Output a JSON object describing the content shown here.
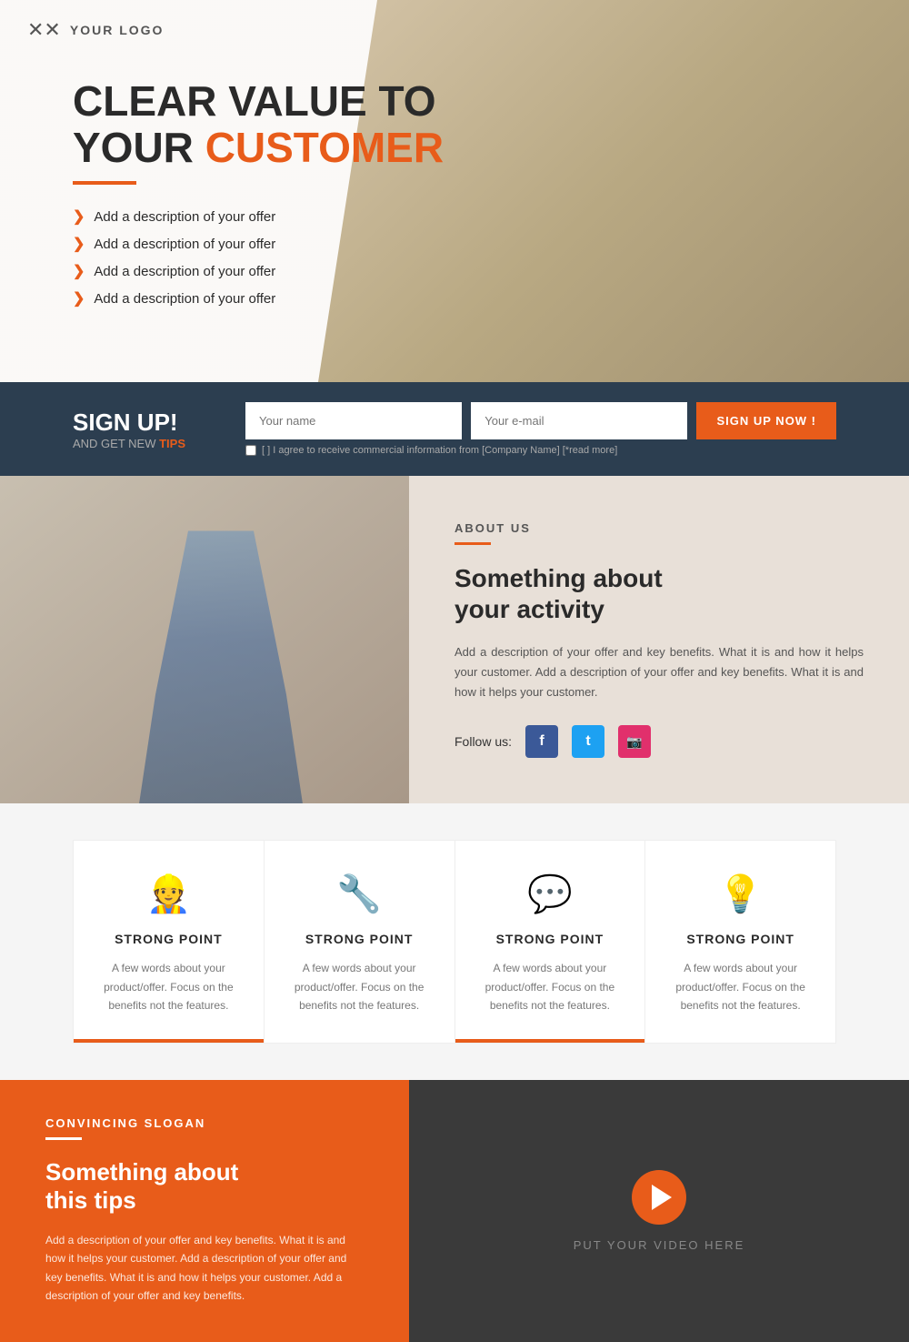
{
  "logo": {
    "icon": "🔧",
    "text": "YOUR LOGO"
  },
  "hero": {
    "title_line1": "CLEAR VALUE TO",
    "title_line2": "YOUR ",
    "title_highlight": "CUSTOMER",
    "features": [
      "Add a description of your offer",
      "Add a description of your offer",
      "Add a description of your offer",
      "Add a description of your offer"
    ]
  },
  "signup": {
    "headline": "SIGN UP!",
    "subline": "AND GET NEW ",
    "subline_highlight": "TIPS",
    "name_placeholder": "Your name",
    "email_placeholder": "Your e-mail",
    "button_label": "SIGN UP NOW !",
    "agree_text": "[ ] I agree to receive commercial information from [Company Name] [*read more]"
  },
  "about": {
    "section_label": "ABOUT US",
    "heading_line1": "Something about",
    "heading_line2": "your activity",
    "description": "Add a description of your offer and key benefits. What it is and how it helps your customer. Add a description of your offer and key benefits. What it is and how it helps your customer.",
    "follow_label": "Follow us:"
  },
  "strong_points": [
    {
      "icon": "👷",
      "title": "STRONG POINT",
      "text": "A few words about your product/offer. Focus on the benefits not the features."
    },
    {
      "icon": "🔧",
      "title": "STRONG POINT",
      "text": "A few words about your product/offer. Focus on the benefits not the features."
    },
    {
      "icon": "💬",
      "title": "STRONG POINT",
      "text": "A few words about your product/offer. Focus on the benefits not the features."
    },
    {
      "icon": "💡",
      "title": "STRONG POINT",
      "text": "A few words about your product/offer. Focus on the benefits not the features."
    }
  ],
  "slogan": {
    "label": "CONVINCING SLOGAN",
    "heading_line1": "Something about",
    "heading_line2": "this tips",
    "text": "Add a description of your offer and key benefits. What it is and how it helps your customer. Add a description of your offer and key benefits. What it is and how it helps your customer. Add a description of your offer and key benefits."
  },
  "video": {
    "label": "PUT YOUR VIDEO HERE"
  },
  "social": {
    "facebook_icon": "f",
    "twitter_icon": "t",
    "instagram_icon": "📷"
  }
}
